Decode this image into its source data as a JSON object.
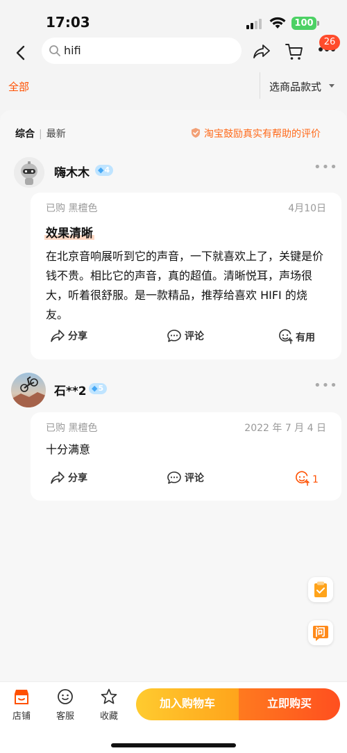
{
  "status_bar": {
    "time": "17:03",
    "battery": "100"
  },
  "nav": {
    "search_value": "hifi",
    "cart_badge": "26"
  },
  "filter": {
    "all_label": "全部",
    "select_label": "选商品款式"
  },
  "sort": {
    "tabs": [
      "综合",
      "最新"
    ],
    "encourage_text": "淘宝鼓励真实有帮助的评价"
  },
  "reviews": [
    {
      "username": "嗨木木",
      "level": "4",
      "purchase": "已购 黑檀色",
      "date": "4月10日",
      "title": "效果清晰",
      "text": "在北京音响展听到它的声音，一下就喜欢上了，关键是价钱不贵。相比它的声音，真的超值。清晰悦耳，声场很大，听着很舒服。是一款精品，推荐给喜欢 HIFI 的烧友。",
      "share_label": "分享",
      "comment_label": "评论",
      "useful_label": "有用"
    },
    {
      "username": "石**2",
      "level": "5",
      "purchase": "已购 黑檀色",
      "date": "2022 年 7 月 4 日",
      "text": "十分满意",
      "share_label": "分享",
      "comment_label": "评论",
      "useful_count": "1"
    }
  ],
  "float": {
    "ask_label": "问"
  },
  "bottom": {
    "store_label": "店铺",
    "service_label": "客服",
    "favorite_label": "收藏",
    "add_cart_label": "加入购物车",
    "buy_now_label": "立即购买"
  },
  "colors": {
    "accent": "#ff5000",
    "cart_gradient": [
      "#ffcb2f",
      "#ffa41b"
    ],
    "buy_gradient": [
      "#ff7a1f",
      "#ff4f1f"
    ]
  }
}
